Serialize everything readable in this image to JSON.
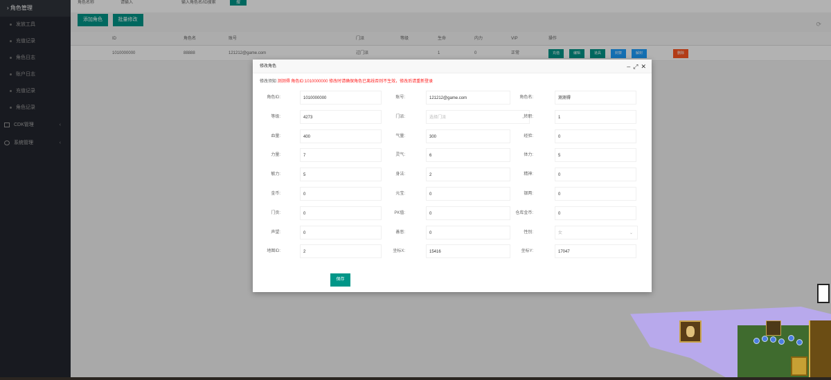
{
  "sidebar": {
    "active": "角色管理",
    "items": [
      "发放工具",
      "充值记录",
      "角色日志",
      "账户日志",
      "充值记录",
      "角色记录"
    ],
    "groups": [
      {
        "label": "CDK管理",
        "icon": "gift-icon"
      },
      {
        "label": "系统管理",
        "icon": "gear-icon"
      }
    ]
  },
  "topbar": {
    "label1": "角色名称",
    "label2": "请输入",
    "label3": "输入角色名/ID搜索",
    "search_label": "搜"
  },
  "toolbar": {
    "btn1": "添加角色",
    "btn2": "批量修改"
  },
  "table": {
    "headers": [
      "ID",
      "角色名",
      "账号",
      "门派",
      "等级",
      "生命",
      "内力",
      "VIP",
      "操作"
    ],
    "row": {
      "id": "1010000000",
      "name": "88888",
      "account": "121212@game.com",
      "sect": "过门派",
      "level": "1",
      "hp": "0",
      "status": "正常",
      "actions": [
        "充值",
        "编辑",
        "道具",
        "封禁",
        "解封",
        "删除"
      ]
    }
  },
  "modal": {
    "title": "修改角色",
    "notice_prefix": "修改须知",
    "notice_name": "测测得",
    "notice_text": "角色ID:1010000000 修改时请确保角色已离线否则不生效，修改后请重新登录",
    "fields": [
      {
        "label": "角色ID:",
        "value": "1010000000"
      },
      {
        "label": "账号:",
        "value": "121212@game.com"
      },
      {
        "label": "角色名:",
        "value": "测测得"
      },
      {
        "label": "等级:",
        "value": "4273"
      },
      {
        "label": "门派:",
        "value": "选择门派",
        "select": true
      },
      {
        "label": "转职:",
        "value": "1"
      },
      {
        "label": "血量:",
        "value": "400"
      },
      {
        "label": "气量:",
        "value": "300"
      },
      {
        "label": "经验:",
        "value": "0"
      },
      {
        "label": "力量:",
        "value": "7"
      },
      {
        "label": "灵气:",
        "value": "6"
      },
      {
        "label": "体力:",
        "value": "5"
      },
      {
        "label": "敏力:",
        "value": "5"
      },
      {
        "label": "身法:",
        "value": "2"
      },
      {
        "label": "精神:",
        "value": "0"
      },
      {
        "label": "金币:",
        "value": "0"
      },
      {
        "label": "元宝:",
        "value": "0"
      },
      {
        "label": "银两:",
        "value": "0"
      },
      {
        "label": "门贡:",
        "value": "0"
      },
      {
        "label": "PK值:",
        "value": "0"
      },
      {
        "label": "仓库金币:",
        "value": "0"
      },
      {
        "label": "声望:",
        "value": "0"
      },
      {
        "label": "善恶:",
        "value": "0"
      },
      {
        "label": "性别:",
        "value": "女",
        "select": true
      },
      {
        "label": "地图ID:",
        "value": "2"
      },
      {
        "label": "坐标X:",
        "value": "15416"
      },
      {
        "label": "坐标Y:",
        "value": "17047"
      }
    ],
    "submit_label": "保存"
  }
}
